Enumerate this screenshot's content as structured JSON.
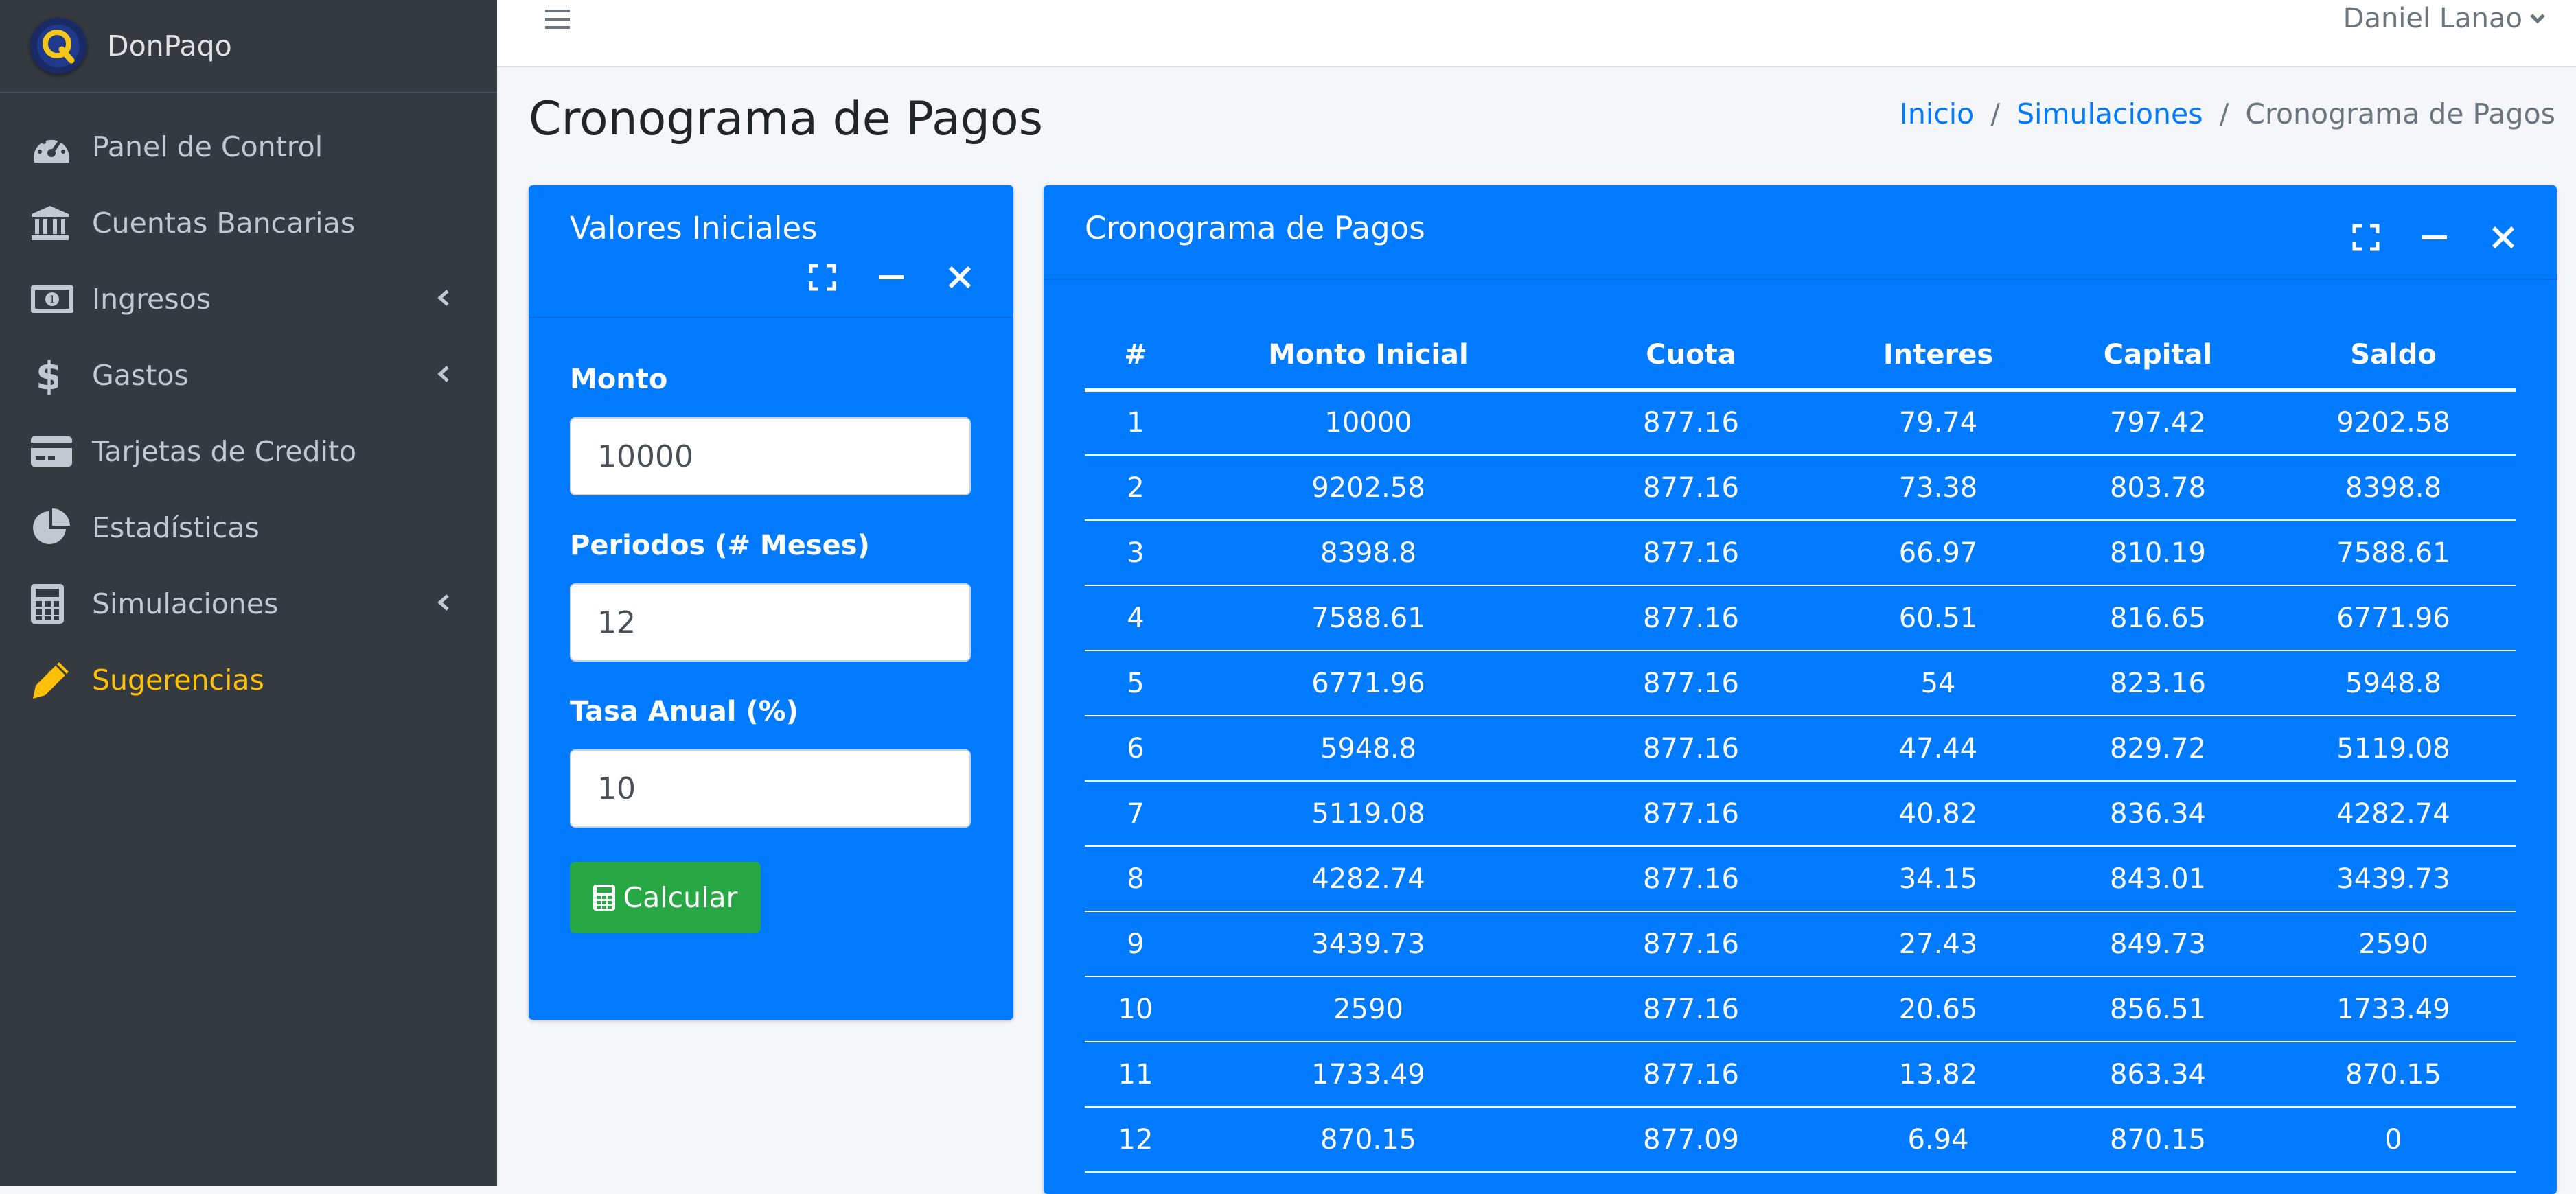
{
  "app": {
    "name": "DonPaqo"
  },
  "sidebar": {
    "items": [
      {
        "label": "Panel de Control",
        "icon": "tachometer-icon",
        "caret": false,
        "active": false
      },
      {
        "label": "Cuentas Bancarias",
        "icon": "bank-icon",
        "caret": false,
        "active": false
      },
      {
        "label": "Ingresos",
        "icon": "money-bill-icon",
        "caret": true,
        "active": false
      },
      {
        "label": "Gastos",
        "icon": "dollar-icon",
        "caret": true,
        "active": false
      },
      {
        "label": "Tarjetas de Credito",
        "icon": "credit-card-icon",
        "caret": false,
        "active": false
      },
      {
        "label": "Estadísticas",
        "icon": "pie-chart-icon",
        "caret": false,
        "active": false
      },
      {
        "label": "Simulaciones",
        "icon": "calculator-icon",
        "caret": true,
        "active": false
      },
      {
        "label": "Sugerencias",
        "icon": "pencil-icon",
        "caret": false,
        "active": true
      }
    ]
  },
  "topbar": {
    "user": "Daniel Lanao"
  },
  "page": {
    "title": "Cronograma de Pagos"
  },
  "breadcrumb": {
    "home": "Inicio",
    "section": "Simulaciones",
    "current": "Cronograma de Pagos"
  },
  "left_card": {
    "title": "Valores Iniciales",
    "fields": {
      "monto": {
        "label": "Monto",
        "value": "10000"
      },
      "periodos": {
        "label": "Periodos (# Meses)",
        "value": "12"
      },
      "tasa": {
        "label": "Tasa Anual (%)",
        "value": "10"
      }
    },
    "button": "Calcular"
  },
  "right_card": {
    "title": "Cronograma de Pagos",
    "table": {
      "headers": [
        "#",
        "Monto Inicial",
        "Cuota",
        "Interes",
        "Capital",
        "Saldo"
      ],
      "rows": [
        [
          "1",
          "10000",
          "877.16",
          "79.74",
          "797.42",
          "9202.58"
        ],
        [
          "2",
          "9202.58",
          "877.16",
          "73.38",
          "803.78",
          "8398.8"
        ],
        [
          "3",
          "8398.8",
          "877.16",
          "66.97",
          "810.19",
          "7588.61"
        ],
        [
          "4",
          "7588.61",
          "877.16",
          "60.51",
          "816.65",
          "6771.96"
        ],
        [
          "5",
          "6771.96",
          "877.16",
          "54",
          "823.16",
          "5948.8"
        ],
        [
          "6",
          "5948.8",
          "877.16",
          "47.44",
          "829.72",
          "5119.08"
        ],
        [
          "7",
          "5119.08",
          "877.16",
          "40.82",
          "836.34",
          "4282.74"
        ],
        [
          "8",
          "4282.74",
          "877.16",
          "34.15",
          "843.01",
          "3439.73"
        ],
        [
          "9",
          "3439.73",
          "877.16",
          "27.43",
          "849.73",
          "2590"
        ],
        [
          "10",
          "2590",
          "877.16",
          "20.65",
          "856.51",
          "1733.49"
        ],
        [
          "11",
          "1733.49",
          "877.16",
          "13.82",
          "863.34",
          "870.15"
        ],
        [
          "12",
          "870.15",
          "877.09",
          "6.94",
          "870.15",
          "0"
        ]
      ]
    }
  },
  "colors": {
    "sidebar_bg": "#343a40",
    "card_primary": "#007bff",
    "button_success": "#28a745",
    "active_item": "#ffc107",
    "link": "#007bff"
  }
}
